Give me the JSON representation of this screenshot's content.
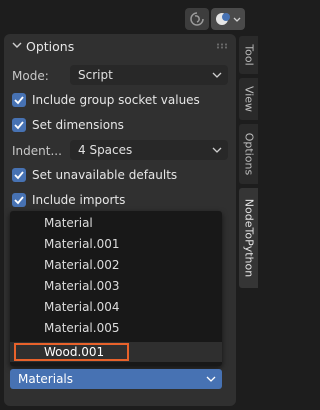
{
  "header": {
    "spin_icon": "rotate-icon",
    "overlay_icon": "sphere-toggle-icon"
  },
  "panel": {
    "title": "Options",
    "mode": {
      "label": "Mode:",
      "value": "Script"
    },
    "checkboxes": [
      {
        "label": "Include group socket values",
        "checked": true
      },
      {
        "label": "Set dimensions",
        "checked": true
      }
    ],
    "indent": {
      "label": "Indent...",
      "value": "4 Spaces"
    },
    "checkboxes2": [
      {
        "label": "Set unavailable defaults",
        "checked": true
      },
      {
        "label": "Include imports",
        "checked": true
      }
    ]
  },
  "dropdown": {
    "items": [
      "Material",
      "Material.001",
      "Material.002",
      "Material.003",
      "Material.004",
      "Material.005",
      "Wood.001"
    ],
    "hovered": "Wood.001"
  },
  "footer": {
    "value": "Materials"
  },
  "sidebar_tabs": [
    "Tool",
    "View",
    "Options",
    "NodeToPython"
  ],
  "colors": {
    "accent": "#4772b3",
    "highlight": "#e8622b",
    "panel": "#303030"
  }
}
